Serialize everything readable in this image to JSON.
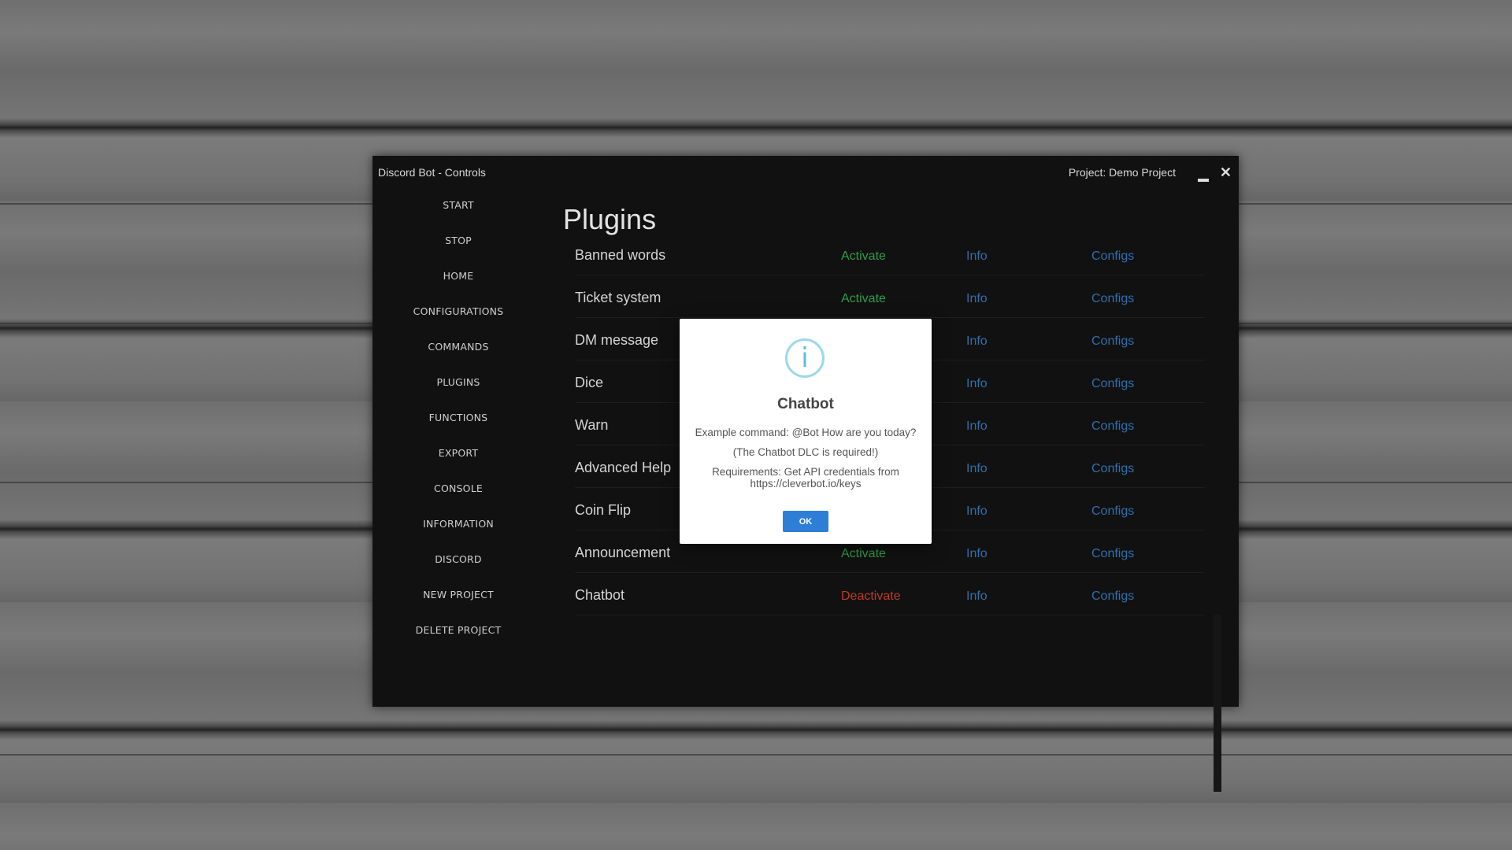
{
  "window": {
    "title": "Discord Bot - Controls",
    "project": "Project: Demo Project",
    "close_glyph": "✕"
  },
  "sidebar": {
    "items": [
      {
        "label": "START"
      },
      {
        "label": "STOP"
      },
      {
        "label": "HOME"
      },
      {
        "label": "CONFIGURATIONS"
      },
      {
        "label": "COMMANDS"
      },
      {
        "label": "PLUGINS"
      },
      {
        "label": "FUNCTIONS"
      },
      {
        "label": "EXPORT"
      },
      {
        "label": "CONSOLE"
      },
      {
        "label": "INFORMATION"
      },
      {
        "label": "DISCORD"
      },
      {
        "label": "NEW PROJECT"
      },
      {
        "label": "DELETE PROJECT"
      }
    ]
  },
  "main": {
    "heading": "Plugins",
    "plugins": [
      {
        "name": "Banned words",
        "action": "Activate",
        "info": "Info",
        "configs": "Configs"
      },
      {
        "name": "Ticket system",
        "action": "Activate",
        "info": "Info",
        "configs": "Configs"
      },
      {
        "name": "DM message",
        "action": "",
        "info": "Info",
        "configs": "Configs"
      },
      {
        "name": "Dice",
        "action": "",
        "info": "Info",
        "configs": "Configs"
      },
      {
        "name": "Warn",
        "action": "",
        "info": "Info",
        "configs": "Configs"
      },
      {
        "name": "Advanced Help",
        "action": "",
        "info": "Info",
        "configs": "Configs"
      },
      {
        "name": "Coin Flip",
        "action": "",
        "info": "Info",
        "configs": "Configs"
      },
      {
        "name": "Announcement",
        "action": "Activate",
        "info": "Info",
        "configs": "Configs"
      },
      {
        "name": "Chatbot",
        "action": "Deactivate",
        "info": "Info",
        "configs": "Configs"
      }
    ]
  },
  "dialog": {
    "icon": "info-icon",
    "icon_glyph": "i",
    "title": "Chatbot",
    "line1": "Example command: @Bot How are you today?",
    "line2": "(The Chatbot DLC is required!)",
    "line3": "Requirements: Get API credentials from",
    "line4": "https://cleverbot.io/keys",
    "ok_label": "OK"
  },
  "colors": {
    "activate": "#2f9b4a",
    "deactivate": "#c23a2a",
    "link": "#2f6fad",
    "ok_button": "#2e7ed6"
  }
}
